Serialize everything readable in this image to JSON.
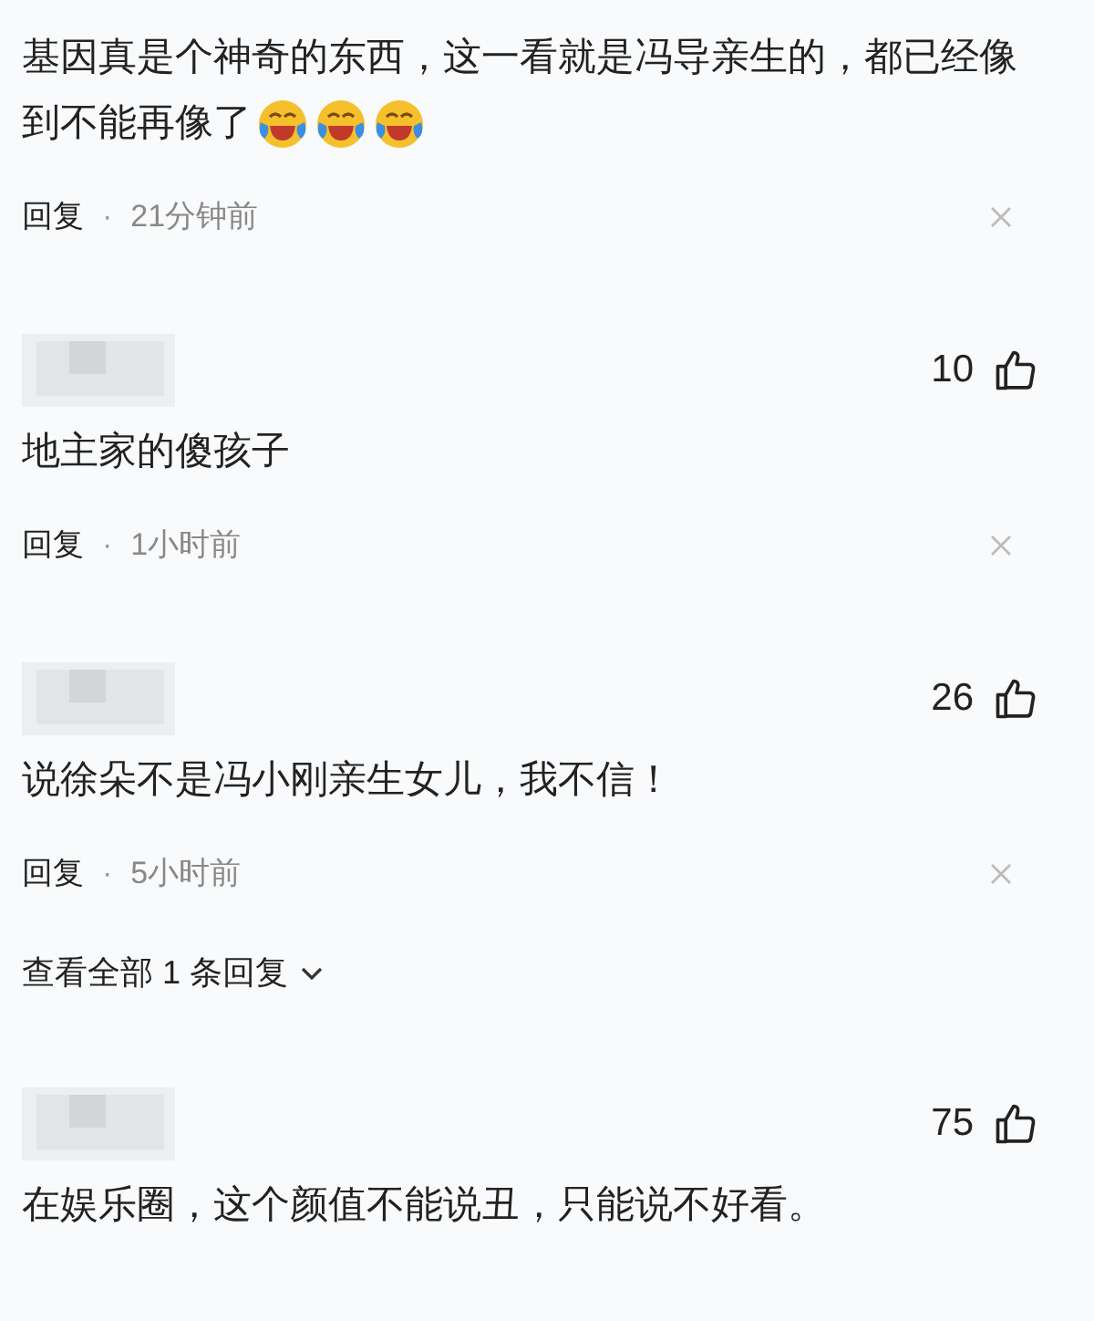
{
  "comments": [
    {
      "text": "基因真是个神奇的东西，这一看就是冯导亲生的，都已经像到不能再像了",
      "emoji_after": true,
      "footer": {
        "reply": "回复",
        "dot": "·",
        "time": "21分钟前"
      }
    },
    {
      "header": {
        "likes": "10"
      },
      "text": "地主家的傻孩子",
      "emoji_after": false,
      "footer": {
        "reply": "回复",
        "dot": "·",
        "time": "1小时前"
      }
    },
    {
      "header": {
        "likes": "26"
      },
      "text": "说徐朵不是冯小刚亲生女儿，我不信！",
      "emoji_after": false,
      "footer": {
        "reply": "回复",
        "dot": "·",
        "time": "5小时前"
      },
      "view_replies": "查看全部 1 条回复"
    },
    {
      "header": {
        "likes": "75"
      },
      "text": "在娱乐圈，这个颜值不能说丑，只能说不好看。",
      "emoji_after": false
    }
  ]
}
